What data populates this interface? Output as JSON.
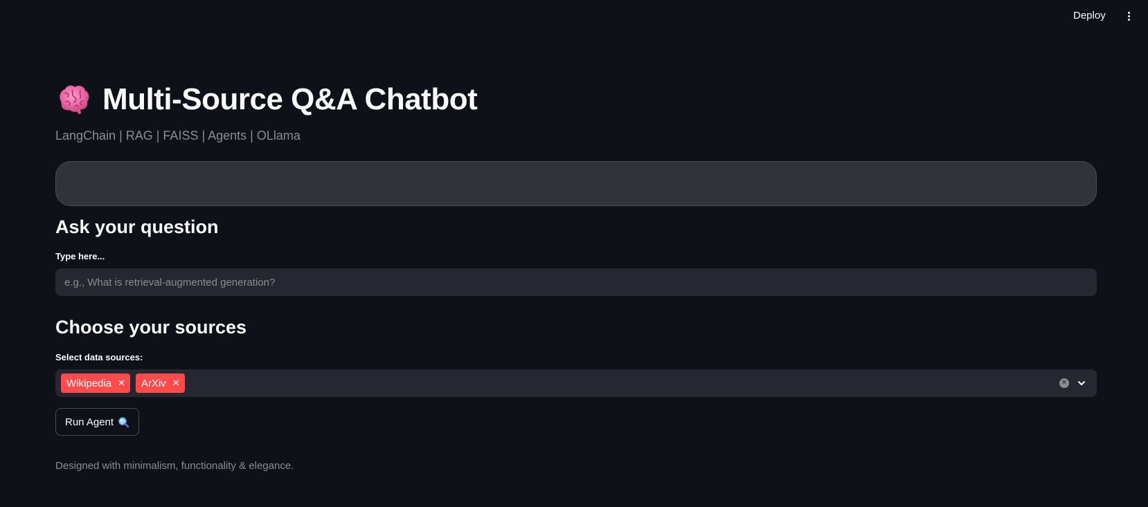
{
  "app": {
    "deploy_label": "Deploy",
    "title_icon": "brain-icon",
    "title": "Multi-Source Q&A Chatbot",
    "subtitle": "LangChain | RAG | FAISS | Agents | OLlama"
  },
  "question_section": {
    "heading": "Ask your question",
    "input_label": "Type here...",
    "input_value": "",
    "input_placeholder": "e.g., What is retrieval-augmented generation?"
  },
  "sources_section": {
    "heading": "Choose your sources",
    "select_label": "Select data sources:",
    "selected": [
      {
        "label": "Wikipedia"
      },
      {
        "label": "ArXiv"
      }
    ]
  },
  "run_button": {
    "label": "Run Agent",
    "icon": "magnifying-glass-icon"
  },
  "footer": {
    "note": "Designed with minimalism, functionality & elegance."
  },
  "colors": {
    "background": "#0e1117",
    "input_background": "#262730",
    "tag_background": "#ff4b4b",
    "text_primary": "#fafafa",
    "text_muted": "#8b8d93"
  }
}
